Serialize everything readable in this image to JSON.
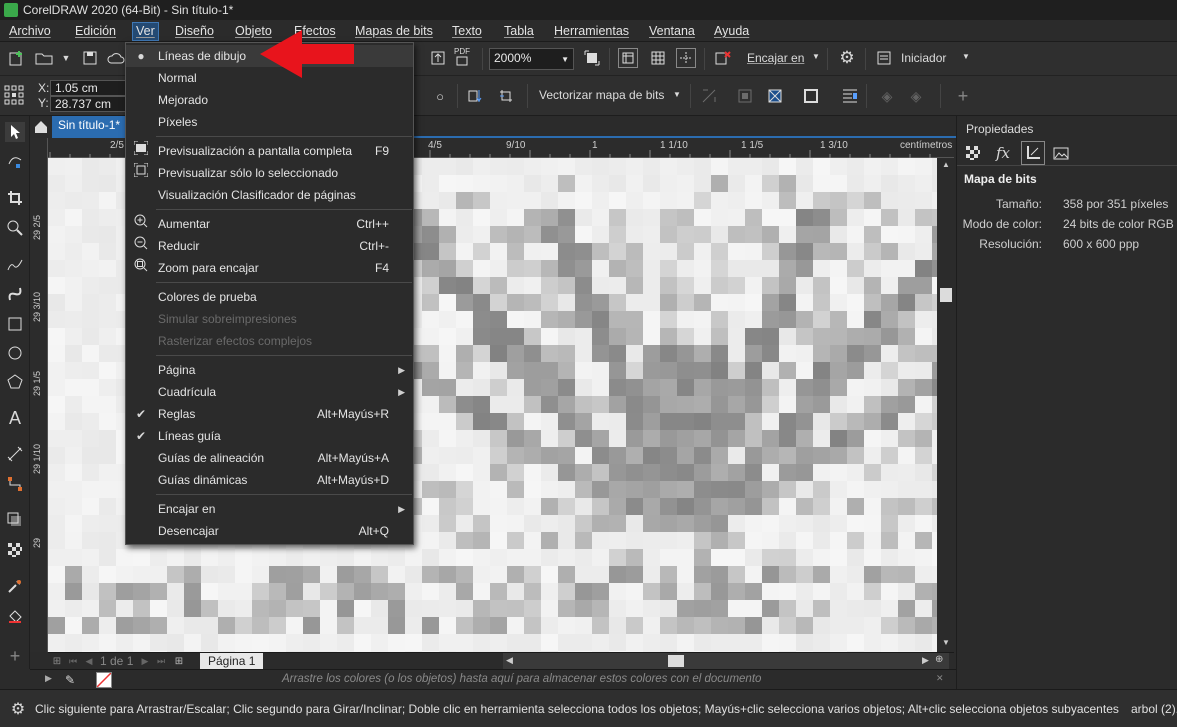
{
  "window": {
    "title": "CorelDRAW 2020 (64-Bit) - Sin título-1*"
  },
  "menubar": [
    {
      "label": "Archivo"
    },
    {
      "label": "Edición"
    },
    {
      "label": "Ver"
    },
    {
      "label": "Diseño"
    },
    {
      "label": "Objeto"
    },
    {
      "label": "Efectos"
    },
    {
      "label": "Mapas de bits"
    },
    {
      "label": "Texto"
    },
    {
      "label": "Tabla"
    },
    {
      "label": "Herramientas"
    },
    {
      "label": "Ventana"
    },
    {
      "label": "Ayuda"
    }
  ],
  "toolbar": {
    "zoom": "2000%",
    "snap_label": "Encajar en",
    "launcher_label": "Iniciador",
    "pdf_label": "PDF"
  },
  "propbar": {
    "x": "1.05 cm",
    "y": "28.737 cm",
    "x_label": "X:",
    "y_label": "Y:",
    "trace_label": "Vectorizar mapa de bits"
  },
  "document": {
    "tab": "Sin título-1*",
    "page_tab": "Página 1",
    "page_count": "1 de 1"
  },
  "ruler_top": [
    "2/5",
    "4/5",
    "9/10",
    "1",
    "1 1/10",
    "1 1/5",
    "1 3/10",
    "centímetros"
  ],
  "ruler_left": [
    "29 2/5",
    "29 3/10",
    "29 1/5",
    "29 1/10",
    "29"
  ],
  "view_menu": {
    "items": [
      {
        "label": "Líneas de dibujo",
        "shortcut": "",
        "glyph": "radio-dot",
        "state": "highlighted"
      },
      {
        "label": "Normal",
        "shortcut": "",
        "glyph": "",
        "state": "enabled"
      },
      {
        "label": "Mejorado",
        "shortcut": "",
        "glyph": "",
        "state": "enabled"
      },
      {
        "label": "Píxeles",
        "shortcut": "",
        "glyph": "",
        "state": "enabled"
      },
      {
        "label": "Previsualización a pantalla completa",
        "shortcut": "F9",
        "glyph": "fullscreen-icon",
        "state": "enabled"
      },
      {
        "label": "Previsualizar sólo lo seleccionado",
        "shortcut": "",
        "glyph": "preview-selected-icon",
        "state": "enabled"
      },
      {
        "label": "Visualización Clasificador de páginas",
        "shortcut": "",
        "glyph": "",
        "state": "enabled"
      },
      {
        "label": "Aumentar",
        "shortcut": "Ctrl++",
        "glyph": "zoom-in-icon",
        "state": "enabled"
      },
      {
        "label": "Reducir",
        "shortcut": "Ctrl+-",
        "glyph": "zoom-out-icon",
        "state": "enabled"
      },
      {
        "label": "Zoom para encajar",
        "shortcut": "F4",
        "glyph": "zoom-fit-icon",
        "state": "enabled"
      },
      {
        "label": "Colores de prueba",
        "shortcut": "",
        "glyph": "",
        "state": "enabled"
      },
      {
        "label": "Simular sobreimpresiones",
        "shortcut": "",
        "glyph": "",
        "state": "disabled"
      },
      {
        "label": "Rasterizar efectos complejos",
        "shortcut": "",
        "glyph": "",
        "state": "disabled"
      },
      {
        "label": "Página",
        "shortcut": "",
        "glyph": "",
        "state": "submenu"
      },
      {
        "label": "Cuadrícula",
        "shortcut": "",
        "glyph": "",
        "state": "submenu"
      },
      {
        "label": "Reglas",
        "shortcut": "Alt+Mayús+R",
        "glyph": "check-icon",
        "state": "enabled"
      },
      {
        "label": "Líneas guía",
        "shortcut": "",
        "glyph": "check-icon",
        "state": "enabled"
      },
      {
        "label": "Guías de alineación",
        "shortcut": "Alt+Mayús+A",
        "glyph": "",
        "state": "enabled"
      },
      {
        "label": "Guías dinámicas",
        "shortcut": "Alt+Mayús+D",
        "glyph": "",
        "state": "enabled"
      },
      {
        "label": "Encajar en",
        "shortcut": "",
        "glyph": "",
        "state": "submenu"
      },
      {
        "label": "Desencajar",
        "shortcut": "Alt+Q",
        "glyph": "",
        "state": "enabled"
      }
    ]
  },
  "properties": {
    "title": "Propiedades",
    "section": "Mapa de bits",
    "rows": [
      {
        "label": "Tamaño:",
        "value": "358 por 351 píxeles"
      },
      {
        "label": "Modo de color:",
        "value": "24 bits de color RGB"
      },
      {
        "label": "Resolución:",
        "value": "600 x 600 ppp"
      }
    ]
  },
  "colorbar": {
    "hint": "Arrastre los colores (o los objetos) hasta aquí para almacenar estos colores con el documento"
  },
  "status": {
    "message": "Clic siguiente para Arrastrar/Escalar; Clic segundo para Girar/Inclinar; Doble clic en herramienta selecciona todos los objetos; Mayús+clic selecciona varios objetos; Alt+clic selecciona objetos subyacentes",
    "object": "arbol (2)..."
  },
  "colors": {
    "accent": "#2b6cb0",
    "arrow": "#e8141c",
    "menu_bg": "#2b2b2b"
  }
}
